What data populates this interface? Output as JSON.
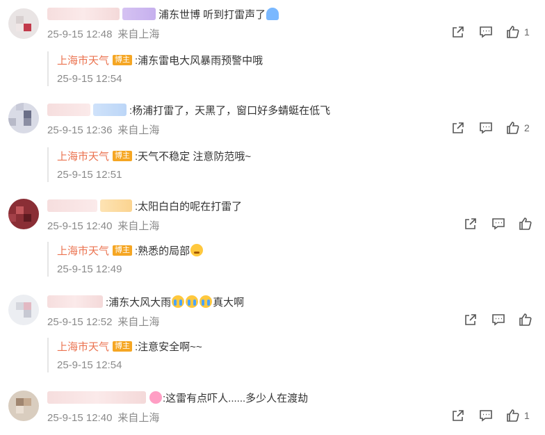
{
  "comments": [
    {
      "text": "浦东世博 听到打雷声了",
      "emoji": "umbrella-rain-emoji",
      "date": "25-9-15 12:48",
      "location": "来自上海",
      "likes": "1",
      "reply": {
        "author": "上海市天气",
        "badge": "博主",
        "text": ":浦东雷电大风暴雨预警中哦",
        "time": "25-9-15 12:54"
      }
    },
    {
      "text": ":杨浦打雷了，天黑了，窗口好多蜻蜓在低飞",
      "date": "25-9-15 12:36",
      "location": "来自上海",
      "likes": "2",
      "reply": {
        "author": "上海市天气",
        "badge": "博主",
        "text": ":天气不稳定 注意防范哦~",
        "time": "25-9-15 12:51"
      }
    },
    {
      "text": ":太阳白白的呢在打雷了",
      "date": "25-9-15 12:40",
      "location": "来自上海",
      "likes": "",
      "reply": {
        "author": "上海市天气",
        "badge": "博主",
        "text": ":熟悉的局部",
        "time": "25-9-15 12:49"
      }
    },
    {
      "text_a": ":浦东大风大雨",
      "text_b": "真大啊",
      "date": "25-9-15 12:52",
      "location": "来自上海",
      "likes": "",
      "reply": {
        "author": "上海市天气",
        "badge": "博主",
        "text": ":注意安全啊~~",
        "time": "25-9-15 12:54"
      }
    },
    {
      "text": ":这雷有点吓人......多少人在渡劫",
      "date": "25-9-15 12:40",
      "location": "来自上海",
      "likes": "1"
    }
  ],
  "colors": {
    "reply_author": "#eb7350",
    "badge": "#f5a623",
    "meta": "#8a8a8a",
    "icon": "#555555"
  }
}
